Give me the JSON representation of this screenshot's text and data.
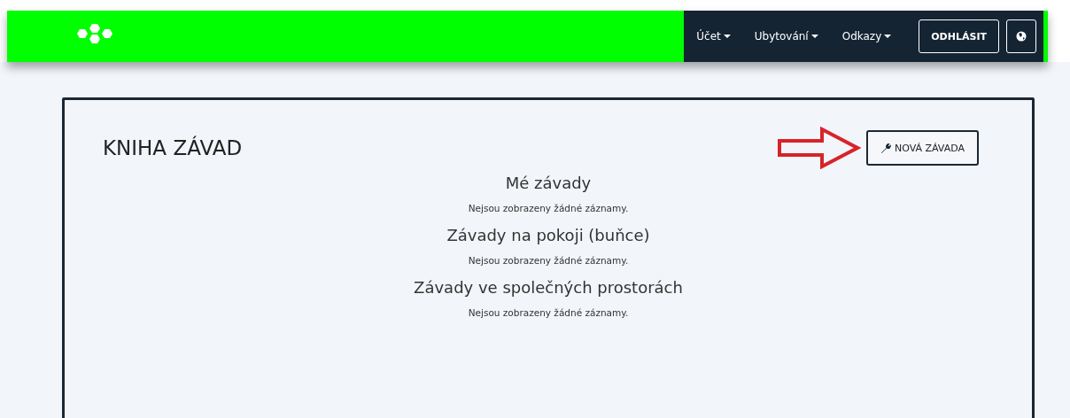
{
  "nav": {
    "menus": [
      {
        "label": "Účet"
      },
      {
        "label": "Ubytování"
      },
      {
        "label": "Odkazy"
      }
    ],
    "logout": "ODHLÁSIT"
  },
  "page": {
    "title": "KNIHA ZÁVAD",
    "new_button": "NOVÁ ZÁVADA",
    "sections": [
      {
        "heading": "Mé závady",
        "empty": "Nejsou zobrazeny žádné záznamy."
      },
      {
        "heading": "Závady na pokoji (buňce)",
        "empty": "Nejsou zobrazeny žádné záznamy."
      },
      {
        "heading": "Závady ve společných prostorách",
        "empty": "Nejsou zobrazeny žádné záznamy."
      }
    ]
  }
}
